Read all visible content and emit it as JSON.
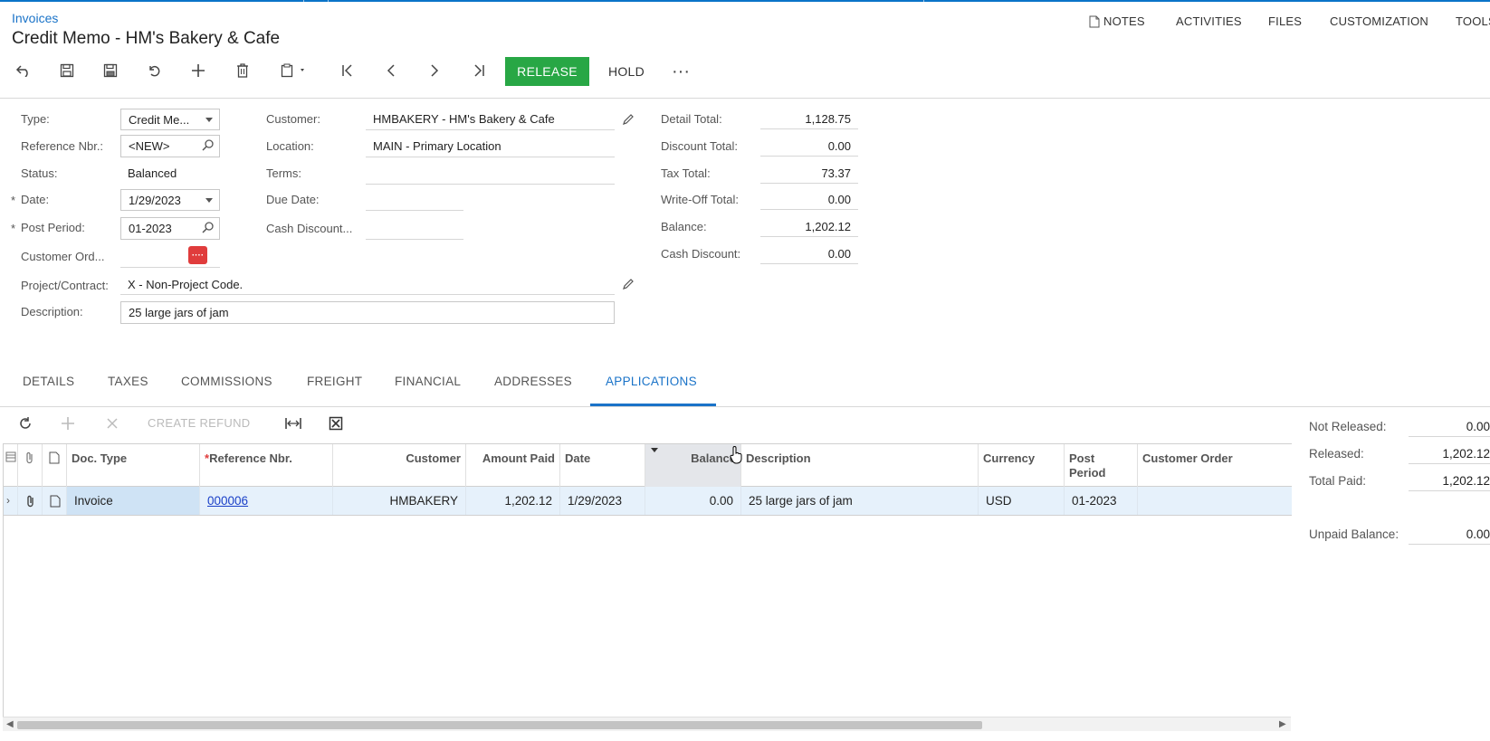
{
  "breadcrumb": "Invoices",
  "page_title": "Credit Memo - HM's Bakery & Cafe",
  "top_nav": {
    "notes": "NOTES",
    "activities": "ACTIVITIES",
    "files": "FILES",
    "customization": "CUSTOMIZATION",
    "tools": "TOOLS"
  },
  "toolbar": {
    "release": "RELEASE",
    "hold": "HOLD",
    "more": "···"
  },
  "form": {
    "type_label": "Type:",
    "type_value": "Credit Me...",
    "refnbr_label": "Reference Nbr.:",
    "refnbr_value": "<NEW>",
    "status_label": "Status:",
    "status_value": "Balanced",
    "date_label": "Date:",
    "date_value": "1/29/2023",
    "postperiod_label": "Post Period:",
    "postperiod_value": "01-2023",
    "custord_label": "Customer Ord...",
    "project_label": "Project/Contract:",
    "project_value": "X - Non-Project Code.",
    "description_label": "Description:",
    "description_value": "25 large jars of jam",
    "customer_label": "Customer:",
    "customer_value": "HMBAKERY - HM's Bakery & Cafe",
    "location_label": "Location:",
    "location_value": "MAIN - Primary Location",
    "terms_label": "Terms:",
    "terms_value": "",
    "duedate_label": "Due Date:",
    "duedate_value": "",
    "cashdisc_label": "Cash Discount...",
    "cashdisc_value": "",
    "required_mark": "*"
  },
  "totals": {
    "detail_label": "Detail Total:",
    "detail_value": "1,128.75",
    "discount_label": "Discount Total:",
    "discount_value": "0.00",
    "tax_label": "Tax Total:",
    "tax_value": "73.37",
    "writeoff_label": "Write-Off Total:",
    "writeoff_value": "0.00",
    "balance_label": "Balance:",
    "balance_value": "1,202.12",
    "cashdisc_label": "Cash Discount:",
    "cashdisc_value": "0.00"
  },
  "tabs": [
    "DETAILS",
    "TAXES",
    "COMMISSIONS",
    "FREIGHT",
    "FINANCIAL",
    "ADDRESSES",
    "APPLICATIONS"
  ],
  "active_tab": "APPLICATIONS",
  "grid_toolbar": {
    "create_refund": "CREATE REFUND"
  },
  "grid": {
    "columns": {
      "doc_type": "Doc. Type",
      "ref_nbr": "Reference Nbr.",
      "customer": "Customer",
      "amount_paid": "Amount Paid",
      "date": "Date",
      "balance": "Balance",
      "description": "Description",
      "currency": "Currency",
      "post_period": "Post Period",
      "customer_order": "Customer Order"
    },
    "rows": [
      {
        "doc_type": "Invoice",
        "ref_nbr": "000006",
        "customer": "HMBAKERY",
        "amount_paid": "1,202.12",
        "date": "1/29/2023",
        "balance": "0.00",
        "description": "25 large jars of jam",
        "currency": "USD",
        "post_period": "01-2023",
        "customer_order": ""
      }
    ]
  },
  "summary": {
    "not_released_label": "Not Released:",
    "not_released_value": "0.00",
    "released_label": "Released:",
    "released_value": "1,202.12",
    "total_paid_label": "Total Paid:",
    "total_paid_value": "1,202.12",
    "unpaid_label": "Unpaid Balance:",
    "unpaid_value": "0.00"
  },
  "colors": {
    "accent": "#1a73c8",
    "release_green": "#28a745",
    "row_selected": "#e6f1fb",
    "error_red": "#e03c3c"
  }
}
